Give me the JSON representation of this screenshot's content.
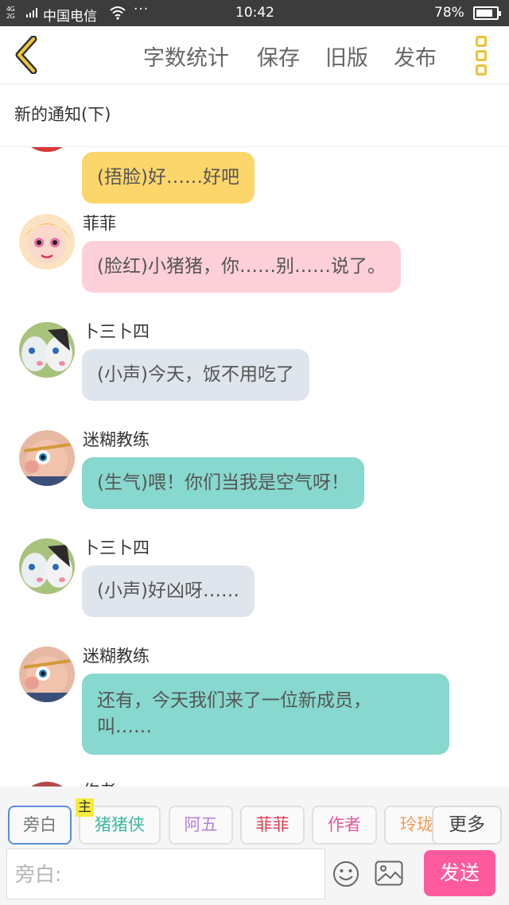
{
  "status_bar": {
    "network": "4G\n2G",
    "carrier": "中国电信",
    "dots": "···",
    "time": "10:42",
    "battery": "78%"
  },
  "toolbar": {
    "back_icon": "chevron-left-icon",
    "items": [
      "字数统计",
      "保存",
      "旧版",
      "发布"
    ],
    "menu_icon": "vertical-menu-icon"
  },
  "chapter": {
    "title": "新的通知(下)"
  },
  "messages": [
    {
      "speaker": "",
      "text": "(捂脸)好……好吧",
      "bubble_color": "#fcd66b"
    },
    {
      "speaker": "菲菲",
      "text": "(脸红)小猪猪，你……别……说了。",
      "bubble_color": "#fdcfd8"
    },
    {
      "speaker": "卜三卜四",
      "text": "(小声)今天，饭不用吃了",
      "bubble_color": "#dfe5ed"
    },
    {
      "speaker": "迷糊教练",
      "text": "(生气)喂！你们当我是空气呀！",
      "bubble_color": "#87d8ce"
    },
    {
      "speaker": "卜三卜四",
      "text": "(小声)好凶呀……",
      "bubble_color": "#dfe5ed"
    },
    {
      "speaker": "迷糊教练",
      "text": "还有，今天我们来了一位新成员，\n叫……",
      "bubble_color": "#87d8ce"
    },
    {
      "speaker": "作者",
      "text": "",
      "bubble_color": "#ffffff"
    }
  ],
  "roles": {
    "main_badge": "主",
    "items": [
      {
        "label": "旁白",
        "color": "#777777"
      },
      {
        "label": "猪猪侠",
        "color": "#3db8a6"
      },
      {
        "label": "阿五",
        "color": "#b57ed8"
      },
      {
        "label": "菲菲",
        "color": "#e0394f"
      },
      {
        "label": "作者",
        "color": "#e8579a"
      },
      {
        "label": "玲珑",
        "color": "#f29a55"
      }
    ],
    "more_label": "更多"
  },
  "input": {
    "placeholder": "旁白:",
    "emoji_icon": "emoji-smile-icon",
    "image_icon": "image-picture-icon",
    "send_label": "发送"
  }
}
